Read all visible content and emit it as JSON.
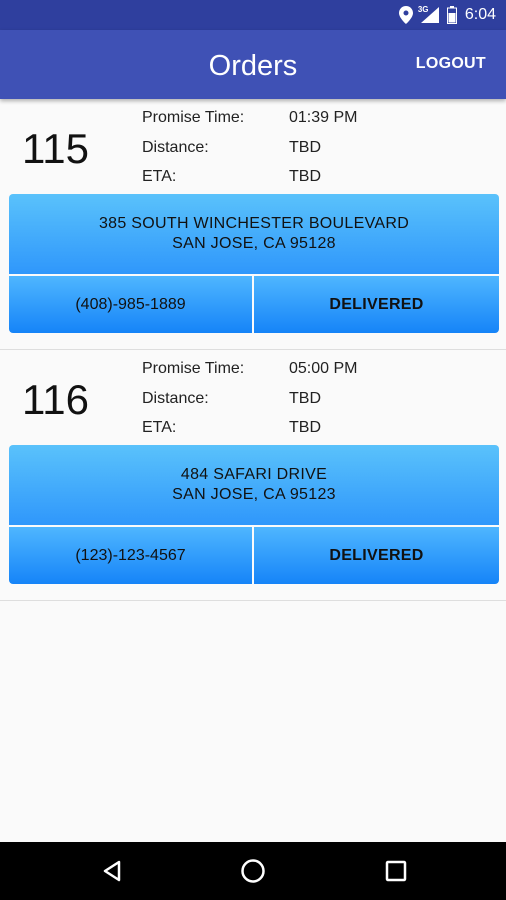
{
  "status_bar": {
    "network_label": "3G",
    "time": "6:04",
    "icons": [
      "location-icon",
      "signal-icon",
      "battery-icon"
    ]
  },
  "app_bar": {
    "title": "Orders",
    "logout_label": "LOGOUT"
  },
  "labels": {
    "promise_time": "Promise Time:",
    "distance": "Distance:",
    "eta": "ETA:"
  },
  "orders": [
    {
      "number": "115",
      "promise_time": "01:39 PM",
      "distance": "TBD",
      "eta": "TBD",
      "address_line1": "385 SOUTH WINCHESTER BOULEVARD",
      "address_line2": "SAN JOSE, CA 95128",
      "phone": "(408)-985-1889",
      "status_label": "DELIVERED"
    },
    {
      "number": "116",
      "promise_time": "05:00 PM",
      "distance": "TBD",
      "eta": "TBD",
      "address_line1": "484 SAFARI DRIVE",
      "address_line2": "SAN JOSE, CA 95123",
      "phone": "(123)-123-4567",
      "status_label": "DELIVERED"
    }
  ],
  "nav_bar": {
    "icons": [
      "back-icon",
      "home-icon",
      "recents-icon"
    ]
  },
  "colors": {
    "status_bar": "#2f3f9e",
    "app_bar": "#3f51b5",
    "button_top": "#5ac2fb",
    "button_bottom": "#1684f8",
    "background": "#fafafa"
  }
}
